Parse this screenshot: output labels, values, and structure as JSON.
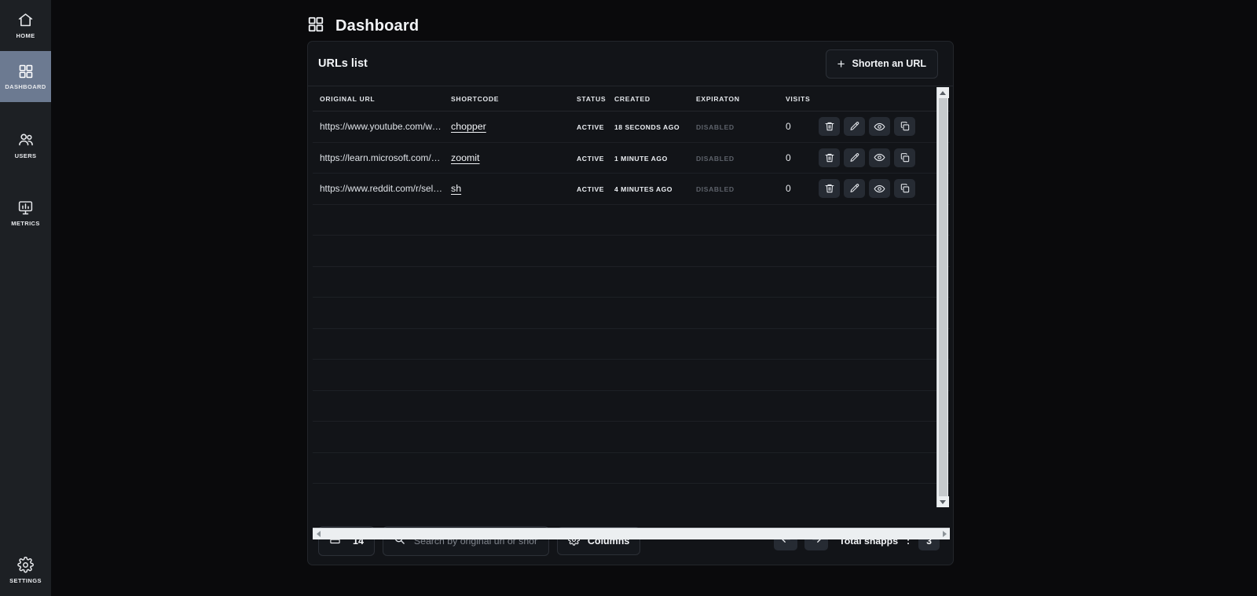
{
  "sidebar": {
    "items": [
      {
        "label": "HOME",
        "icon": "home-icon",
        "active": false
      },
      {
        "label": "DASHBOARD",
        "icon": "grid-icon",
        "active": true
      },
      {
        "label": "USERS",
        "icon": "users-icon",
        "active": false
      },
      {
        "label": "METRICS",
        "icon": "metrics-icon",
        "active": false
      }
    ],
    "bottom": {
      "label": "SETTINGS",
      "icon": "gear-icon"
    }
  },
  "header": {
    "title": "Dashboard",
    "icon": "grid-icon"
  },
  "card": {
    "title": "URLs list",
    "shorten_button": {
      "label": "Shorten an URL",
      "icon": "plus-icon"
    }
  },
  "table": {
    "columns": [
      "ORIGINAL URL",
      "SHORTCODE",
      "STATUS",
      "CREATED",
      "EXPIRATON",
      "VISITS"
    ],
    "rows": [
      {
        "original_url": "https://www.youtube.com/w…",
        "shortcode": "chopper",
        "status": "ACTIVE",
        "created": "18 SECONDS AGO",
        "expiration": "DISABLED",
        "visits": "0",
        "actions": [
          "trash-icon",
          "pencil-icon",
          "eye-icon",
          "copy-icon"
        ]
      },
      {
        "original_url": "https://learn.microsoft.com/…",
        "shortcode": "zoomit",
        "status": "ACTIVE",
        "created": "1 MINUTE AGO",
        "expiration": "DISABLED",
        "visits": "0",
        "actions": [
          "trash-icon",
          "pencil-icon",
          "eye-icon",
          "copy-icon"
        ]
      },
      {
        "original_url": "https://www.reddit.com/r/sel…",
        "shortcode": "sh",
        "status": "ACTIVE",
        "created": "4 MINUTES AGO",
        "expiration": "DISABLED",
        "visits": "0",
        "actions": [
          "trash-icon",
          "pencil-icon",
          "eye-icon",
          "copy-icon"
        ]
      }
    ],
    "empty_row_count": 12
  },
  "footer": {
    "rows_per_page": "14",
    "rows_icon": "rows-icon",
    "search": {
      "placeholder": "Search by original url or shortcode",
      "value": "",
      "icon": "search-icon"
    },
    "columns_button": {
      "label": "Columns",
      "icon": "gear-icon"
    },
    "prev_icon": "arrow-left-icon",
    "next_icon": "arrow-right-icon",
    "total_label": "Total snapps",
    "total_separator": ":",
    "total_value": "3"
  },
  "colors": {
    "sidebar_bg": "#1d2024",
    "sidebar_active": "#6c7a91",
    "page_bg": "#0a0a0c",
    "card_bg": "#121418",
    "border": "#23262b",
    "text": "#f2f4f7",
    "muted": "#5d626a",
    "action_btn": "#262b33",
    "scrollbar": "#eceff1"
  }
}
